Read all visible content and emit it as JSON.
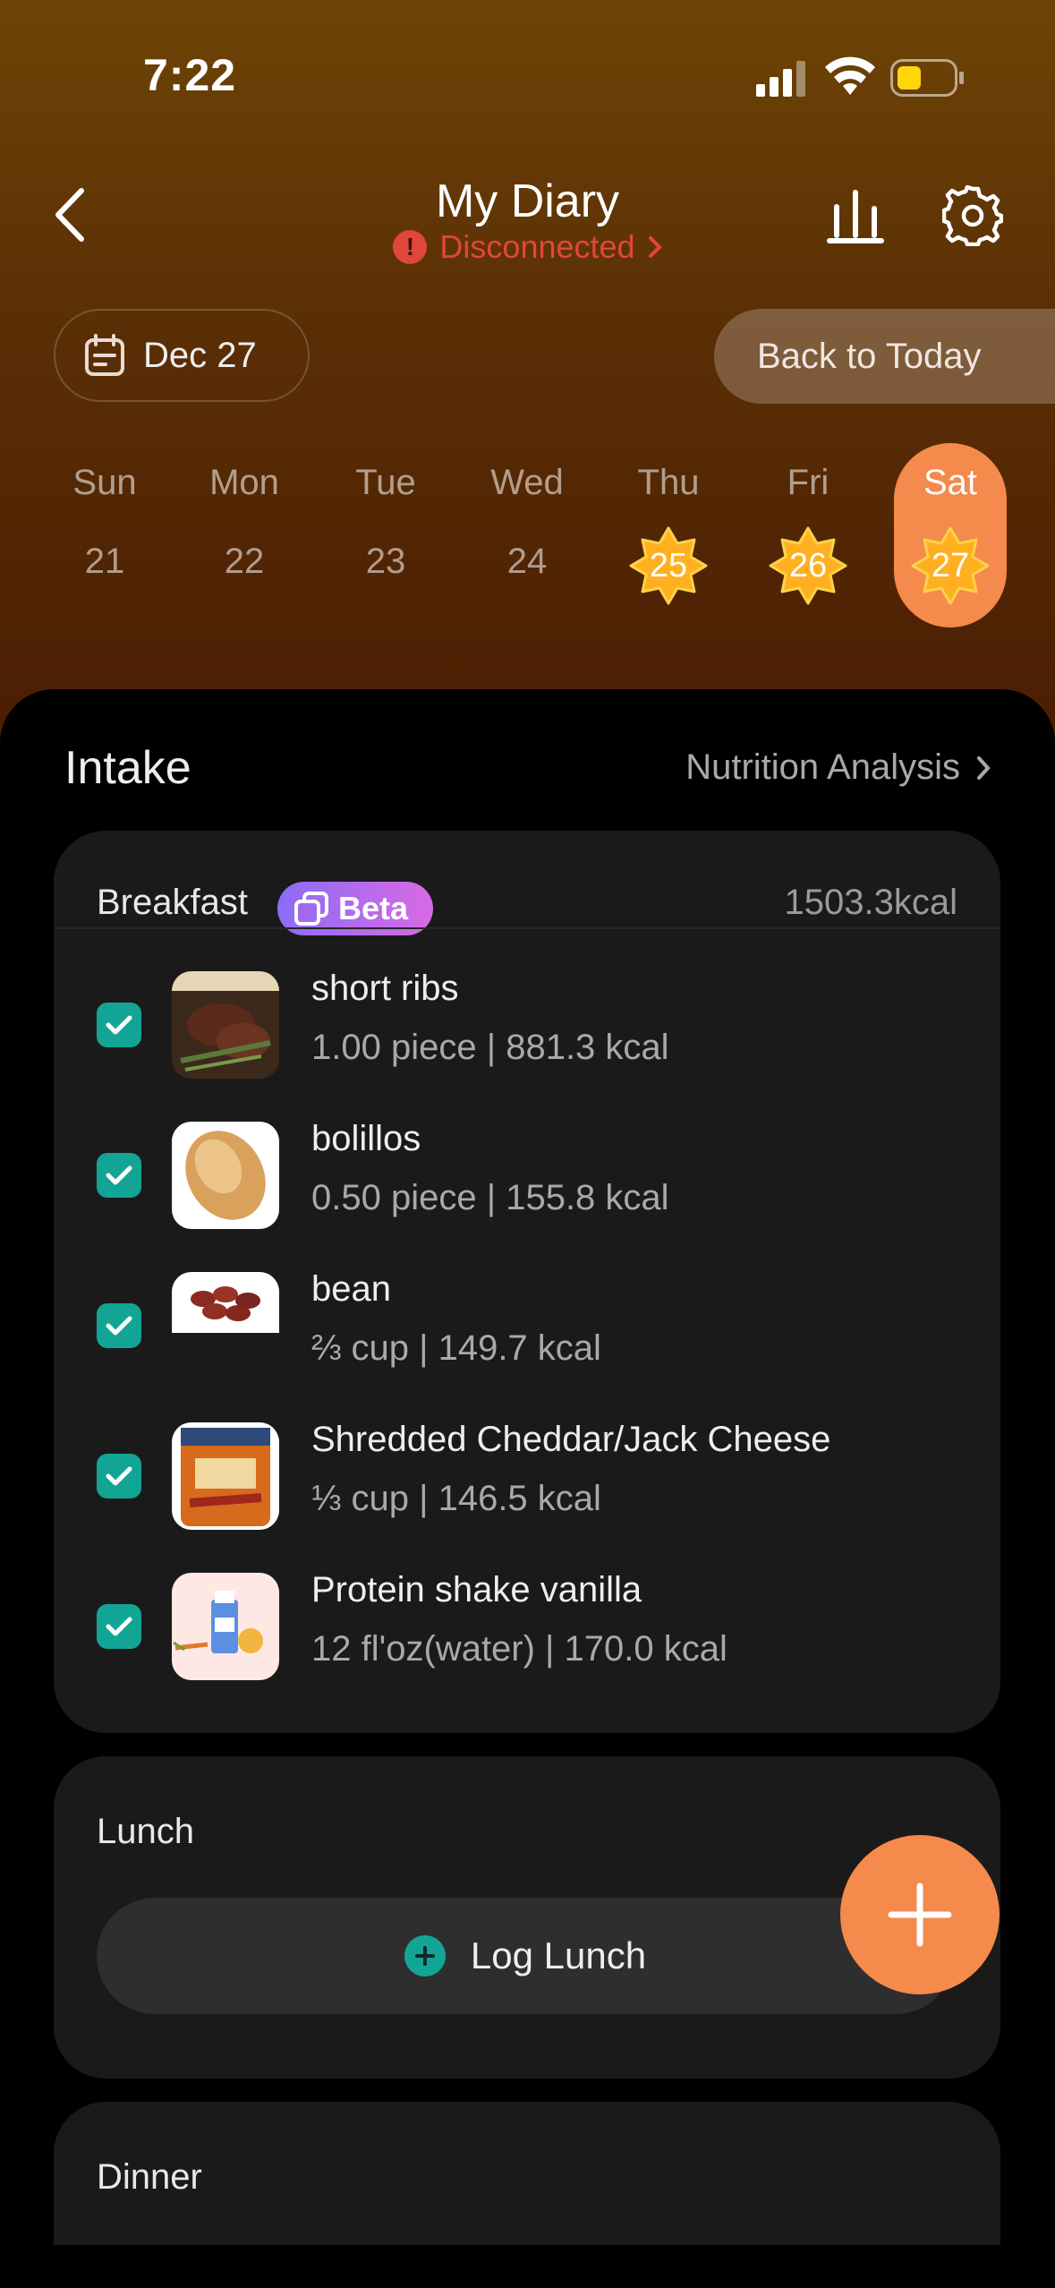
{
  "status": {
    "time": "7:22"
  },
  "header": {
    "title": "My Diary",
    "connection": "Disconnected"
  },
  "date_picker": {
    "label": "Dec 27"
  },
  "back_to_today": "Back to Today",
  "week": [
    {
      "name": "Sun",
      "date": "21"
    },
    {
      "name": "Mon",
      "date": "22"
    },
    {
      "name": "Tue",
      "date": "23"
    },
    {
      "name": "Wed",
      "date": "24"
    },
    {
      "name": "Thu",
      "date": "25"
    },
    {
      "name": "Fri",
      "date": "26"
    },
    {
      "name": "Sat",
      "date": "27"
    }
  ],
  "intake": {
    "title": "Intake",
    "analysis_link": "Nutrition Analysis"
  },
  "breakfast": {
    "title": "Breakfast",
    "badge": "Beta",
    "total": "1503.3kcal",
    "items": [
      {
        "name": "short ribs",
        "detail": "1.00 piece | 881.3 kcal"
      },
      {
        "name": "bolillos",
        "detail": "0.50 piece | 155.8 kcal"
      },
      {
        "name": "bean",
        "detail": "⅔ cup | 149.7 kcal"
      },
      {
        "name": "Shredded Cheddar/Jack Cheese",
        "detail": "⅓ cup | 146.5 kcal"
      },
      {
        "name": "Protein shake vanilla",
        "detail": "12 fl'oz(water) | 170.0 kcal"
      }
    ]
  },
  "lunch": {
    "title": "Lunch",
    "button": "Log Lunch"
  },
  "dinner": {
    "title": "Dinner"
  },
  "colors": {
    "accent": "#f48a4b",
    "teal": "#12a596",
    "error": "#e1463c"
  }
}
